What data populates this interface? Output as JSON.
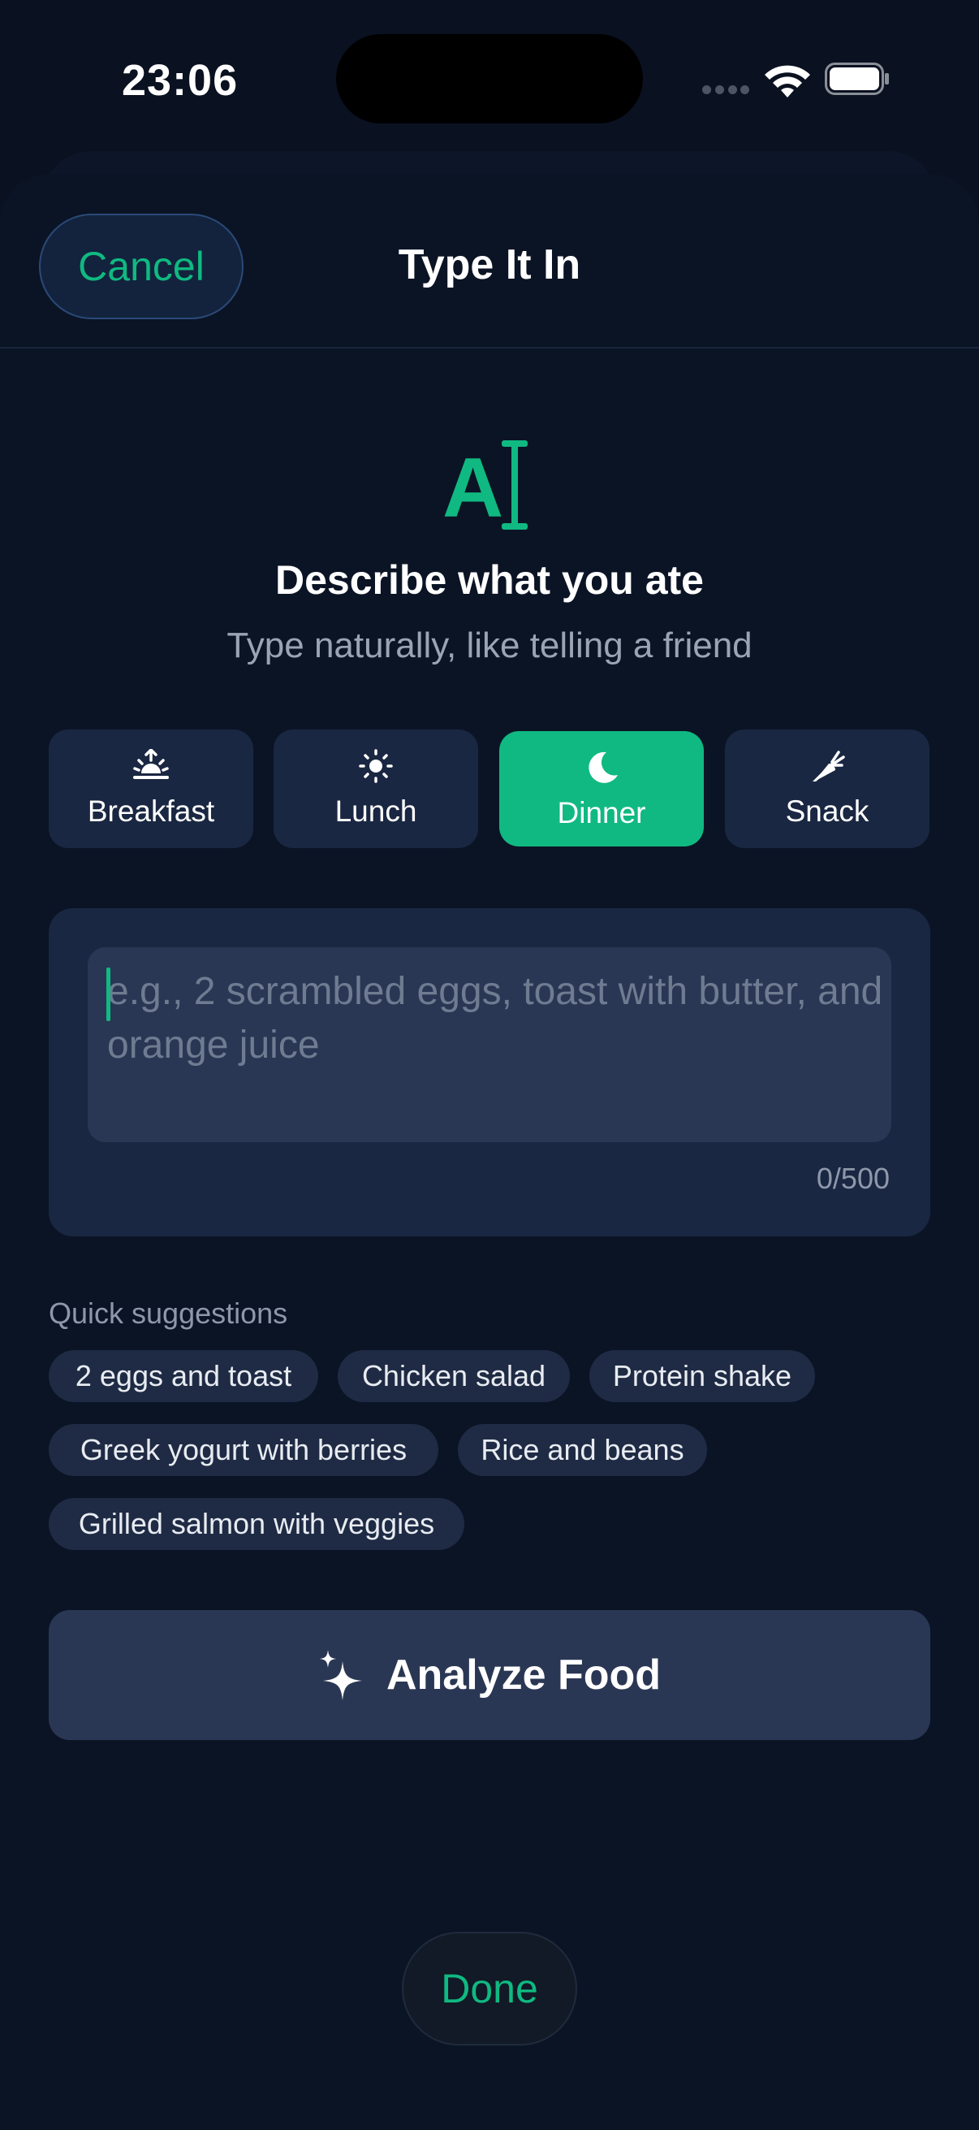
{
  "status_bar": {
    "time": "23:06"
  },
  "nav": {
    "cancel_label": "Cancel",
    "title": "Type It In"
  },
  "hero": {
    "icon": "text-cursor-icon",
    "icon_letter": "A",
    "heading": "Describe what you ate",
    "subheading": "Type naturally, like telling a friend"
  },
  "meal_types": [
    {
      "label": "Breakfast",
      "icon": "sunrise-icon",
      "selected": false
    },
    {
      "label": "Lunch",
      "icon": "sun-icon",
      "selected": false
    },
    {
      "label": "Dinner",
      "icon": "moon-icon",
      "selected": true
    },
    {
      "label": "Snack",
      "icon": "carrot-icon",
      "selected": false
    }
  ],
  "input": {
    "value": "",
    "placeholder": "e.g., 2 scrambled eggs, toast with butter, and orange juice",
    "counter": "0/500"
  },
  "suggestions": {
    "label": "Quick suggestions",
    "items": [
      "2 eggs and toast",
      "Chicken salad",
      "Protein shake",
      "Greek yogurt with berries",
      "Rice and beans",
      "Grilled salmon with veggies"
    ]
  },
  "analyze": {
    "label": "Analyze Food",
    "icon": "sparkles-icon"
  },
  "done": {
    "label": "Done"
  },
  "colors": {
    "accent": "#10b981",
    "background": "#0a1120",
    "card": "#1a2742",
    "input": "#2a3754",
    "muted_text": "#9aa4b4"
  }
}
